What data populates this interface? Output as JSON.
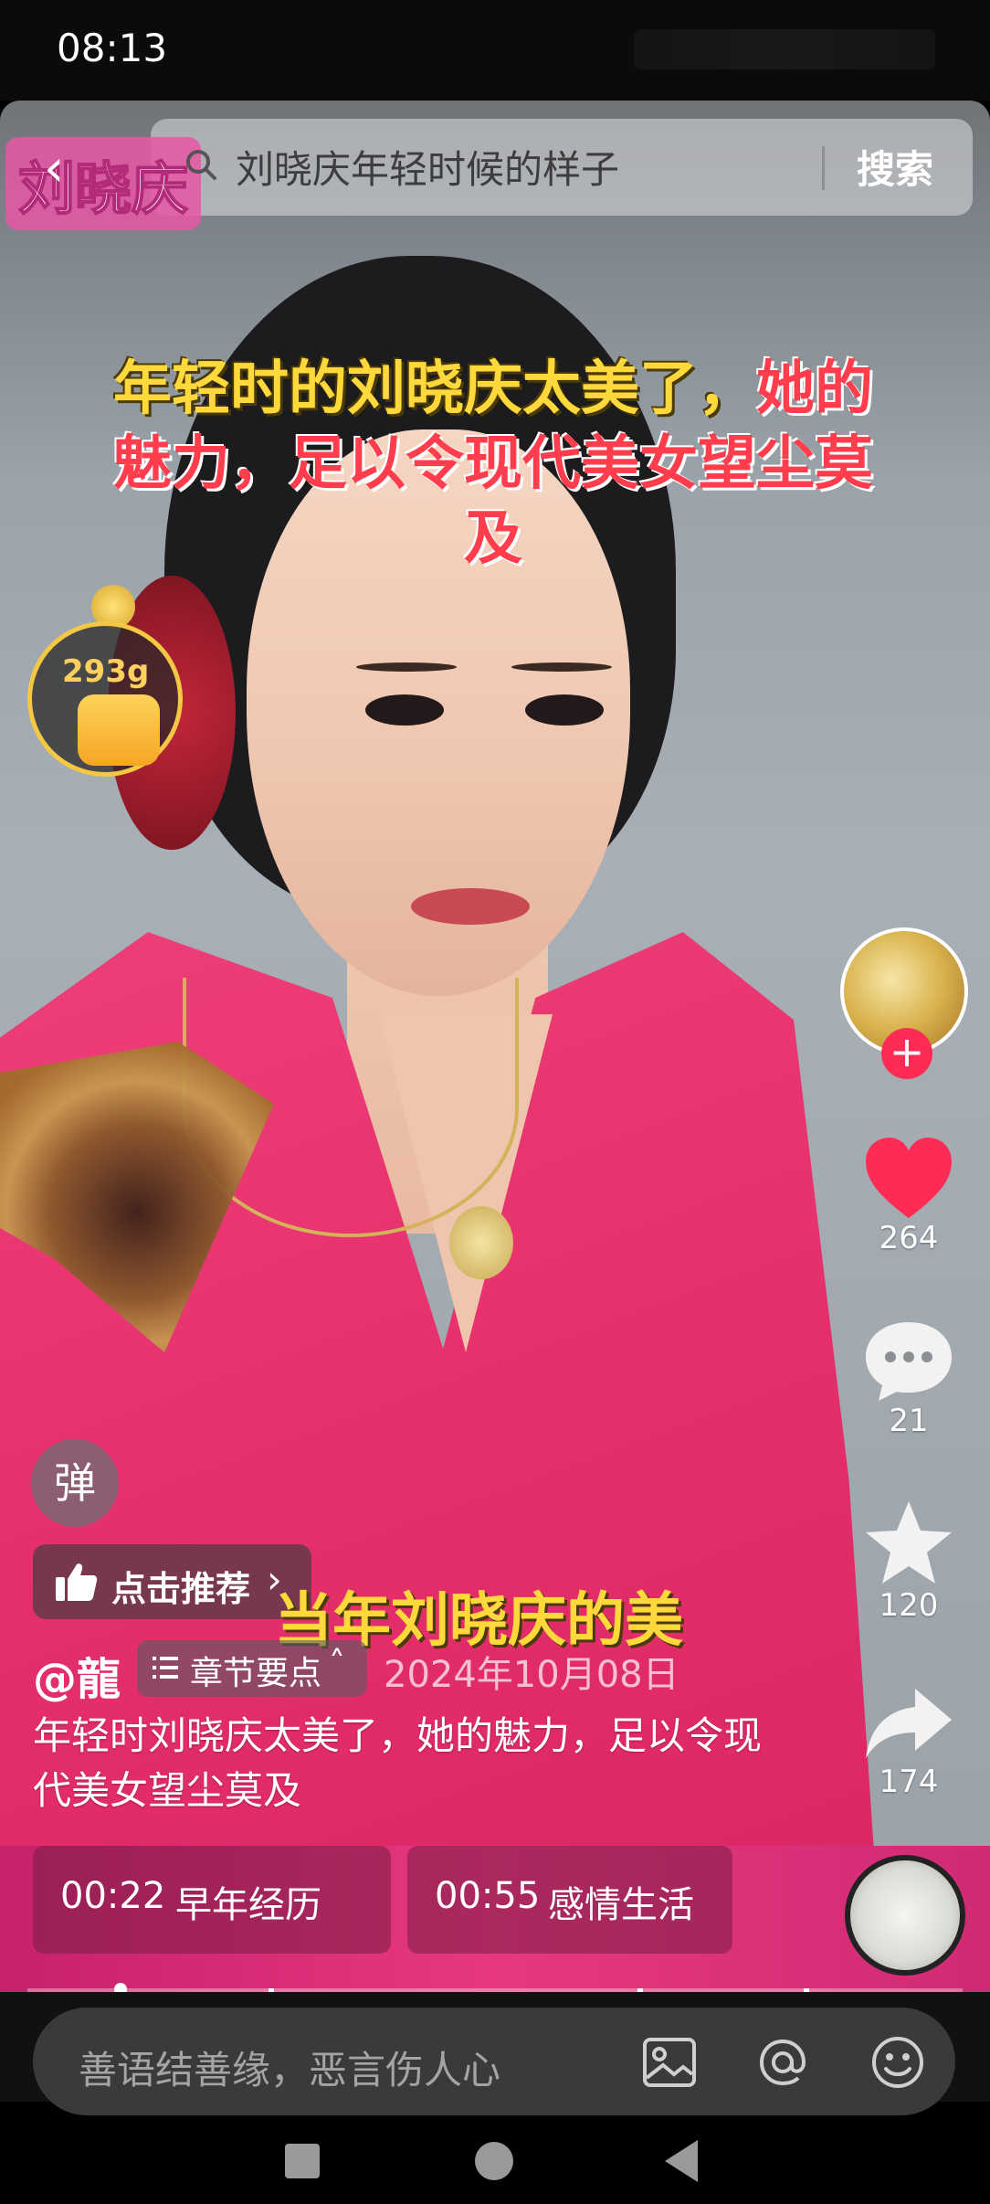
{
  "status_bar": {
    "time": "08:13"
  },
  "search": {
    "name_badge": "刘晓庆",
    "query": "刘晓庆年轻时候的样子",
    "button": "搜索"
  },
  "video_caption": {
    "line1_yellow": "年轻时的刘晓庆太美了，",
    "line1_red": "她的",
    "line2_red": "魅力，足以令现代美女望尘莫",
    "line3_yellow": "及"
  },
  "reward": {
    "count": "293g"
  },
  "side_actions": {
    "like_count": "264",
    "comment_count": "21",
    "favorite_count": "120",
    "share_count": "174"
  },
  "danmu_label": "弹",
  "recommend_label": "点击推荐",
  "bottom_subtitle": "当年刘晓庆的美",
  "post": {
    "author": "@龍",
    "chapter_label": "章节要点",
    "date": "2024年10月08日",
    "description": "年轻时刘晓庆太美了，她的魅力，足以令现代美女望尘莫及"
  },
  "chapters": [
    {
      "time": "00:22",
      "title": "早年经历"
    },
    {
      "time": "00:55",
      "title": "感情生活"
    }
  ],
  "progress": {
    "fraction": 0.1
  },
  "comment": {
    "placeholder": "善语结善缘，恶言伤人心"
  },
  "icons": [
    "back-icon",
    "search-icon",
    "heart-icon",
    "comment-icon",
    "star-icon",
    "share-icon",
    "thumb-up-icon",
    "image-icon",
    "at-icon",
    "emoji-icon"
  ],
  "colors": {
    "accent": "#fe2c55",
    "like": "#fe2c55",
    "caption_yellow": "#ffd93b",
    "caption_red": "#ff3d4d"
  }
}
